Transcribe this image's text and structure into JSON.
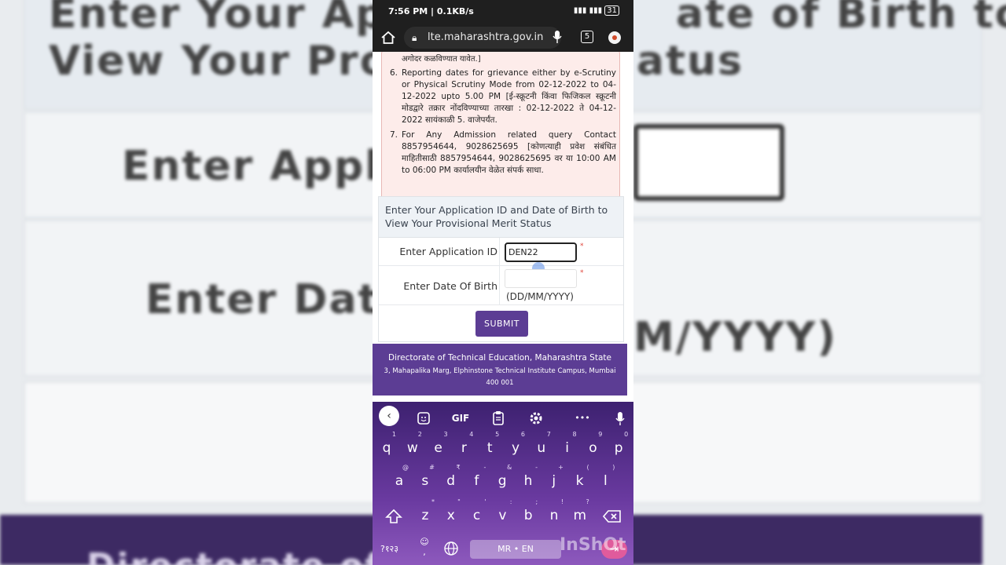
{
  "background": {
    "heading_line1": "Enter Your Applic",
    "heading_line1_right": "ate of Birth to",
    "heading_line2": "View Your Provisi",
    "heading_line2_right": "atus",
    "label_app": "Enter Applicat",
    "label_dob": "Enter Date O",
    "hint_fragment": "M/YYYY)",
    "footer_fragment": "Directorate of Tec"
  },
  "statusbar": {
    "time": "7:56 PM | 0.1KB/s",
    "battery": "31"
  },
  "browser": {
    "url": "lte.maharashtra.gov.in",
    "tab_count": "5"
  },
  "notice": {
    "fragment_top": "अगोदर कळविण्यात यावेत.]",
    "items": [
      {
        "num": "6.",
        "text": "Reporting dates for grievance either by e-Scrutiny or Physical Scrutiny Mode from 02-12-2022 to 04-12-2022 upto 5.00 PM [ई-स्क्रूटनी किंवा फिजिकल स्क्रूटनी मोडद्वारे तक्रार नोंदविण्याच्या तारखा : 02-12-2022 ते 04-12-2022 सायंकाळी 5. वाजेपर्यंत."
      },
      {
        "num": "7.",
        "text": "For Any Admission related query Contact 8857954644, 9028625695 [कोणत्याही प्रवेश संबंधित माहितीसाठी 8857954644, 9028625695 वर या 10:00 AM to 06:00 PM कार्यालयीन वेळेत संपर्क साधा."
      }
    ]
  },
  "form": {
    "heading": "Enter Your Application ID and Date of Birth to View Your Provisional Merit Status",
    "app_id_label": "Enter Application ID",
    "app_id_value": "DEN22",
    "dob_label": "Enter Date Of Birth",
    "dob_hint": "(DD/MM/YYYY)",
    "required_mark": "*",
    "submit_label": "SUBMIT"
  },
  "footer": {
    "title": "Directorate of Technical Education, Maharashtra State",
    "address": "3, Mahapalika Marg, Elphinstone Technical Institute Campus, Mumbai 400 001"
  },
  "keyboard": {
    "toolbar": {
      "gif": "GIF",
      "more": "•••"
    },
    "row1": [
      [
        "q",
        "1"
      ],
      [
        "w",
        "2"
      ],
      [
        "e",
        "3"
      ],
      [
        "r",
        "4"
      ],
      [
        "t",
        "5"
      ],
      [
        "y",
        "6"
      ],
      [
        "u",
        "7"
      ],
      [
        "i",
        "8"
      ],
      [
        "o",
        "9"
      ],
      [
        "p",
        "0"
      ]
    ],
    "row2": [
      [
        "a",
        "@"
      ],
      [
        "s",
        "#"
      ],
      [
        "d",
        "₹"
      ],
      [
        "f",
        "-"
      ],
      [
        "g",
        "&"
      ],
      [
        "h",
        "-"
      ],
      [
        "j",
        "+"
      ],
      [
        "k",
        "("
      ],
      [
        "l",
        ")"
      ]
    ],
    "row3": [
      [
        "z",
        "*"
      ],
      [
        "x",
        "\""
      ],
      [
        "c",
        "'"
      ],
      [
        "v",
        ":"
      ],
      [
        "b",
        ";"
      ],
      [
        "n",
        "!"
      ],
      [
        "m",
        "?"
      ]
    ],
    "symbols_key": "?१२३",
    "comma": ",",
    "space_label": "MR • EN",
    "watermark": "InShOt"
  }
}
